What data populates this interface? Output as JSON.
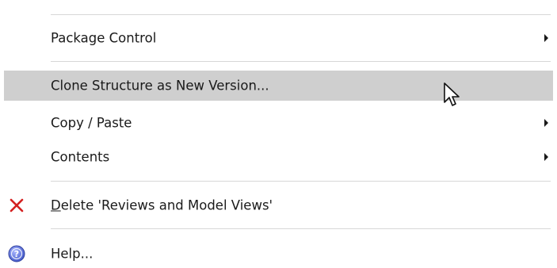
{
  "menu": {
    "items": [
      {
        "label": "Package Control",
        "has_submenu": true
      },
      {
        "label": "Clone Structure as New Version...",
        "has_submenu": false,
        "highlighted": true
      },
      {
        "label": "Copy / Paste",
        "has_submenu": true
      },
      {
        "label": "Contents",
        "has_submenu": true
      },
      {
        "label_prefix": "D",
        "label_rest": "elete 'Reviews and Model Views'",
        "icon": "delete-x-icon",
        "icon_color": "#d42020"
      },
      {
        "label": "Help...",
        "icon": "help-icon",
        "icon_color": "#4c63d2"
      }
    ]
  },
  "colors": {
    "highlight": "#cfcfcf",
    "separator": "#d7d7d7"
  }
}
